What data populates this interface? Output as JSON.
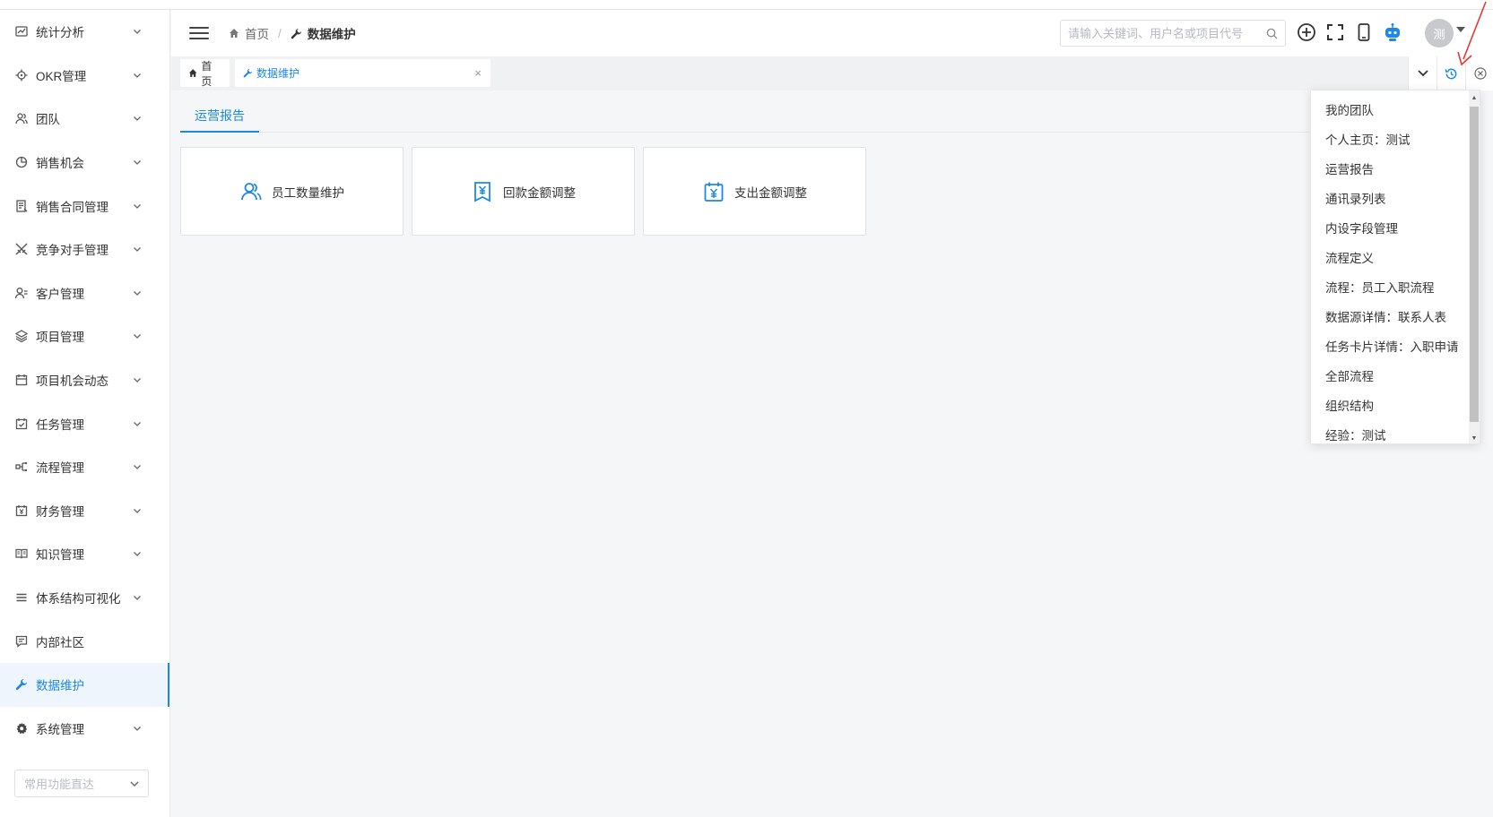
{
  "sidebar": {
    "items": [
      {
        "label": "统计分析",
        "icon": "chart-icon"
      },
      {
        "label": "OKR管理",
        "icon": "target-icon"
      },
      {
        "label": "团队",
        "icon": "team-icon"
      },
      {
        "label": "销售机会",
        "icon": "pie-icon"
      },
      {
        "label": "销售合同管理",
        "icon": "contract-icon"
      },
      {
        "label": "竞争对手管理",
        "icon": "swords-icon"
      },
      {
        "label": "客户管理",
        "icon": "customer-icon"
      },
      {
        "label": "项目管理",
        "icon": "layers-icon"
      },
      {
        "label": "项目机会动态",
        "icon": "calendar-icon"
      },
      {
        "label": "任务管理",
        "icon": "task-icon"
      },
      {
        "label": "流程管理",
        "icon": "flow-icon"
      },
      {
        "label": "财务管理",
        "icon": "finance-icon"
      },
      {
        "label": "知识管理",
        "icon": "book-icon"
      },
      {
        "label": "体系结构可视化",
        "icon": "menu-icon"
      },
      {
        "label": "内部社区",
        "icon": "comment-icon"
      },
      {
        "label": "数据维护",
        "icon": "wrench-icon"
      },
      {
        "label": "系统管理",
        "icon": "gear-icon"
      }
    ],
    "quick_select_placeholder": "常用功能直达"
  },
  "header": {
    "breadcrumb_home": "首页",
    "breadcrumb_current": "数据维护",
    "search_placeholder": "请输入关键词、用户名或项目代号",
    "avatar_text": "测"
  },
  "tabs": [
    {
      "label": "首页"
    },
    {
      "label": "数据维护"
    }
  ],
  "subtab": "运营报告",
  "cards": [
    {
      "label": "员工数量维护",
      "icon": "users-icon"
    },
    {
      "label": "回款金额调整",
      "icon": "yen-receipt-icon"
    },
    {
      "label": "支出金额调整",
      "icon": "yen-calendar-icon"
    }
  ],
  "history_dropdown": [
    "我的团队",
    "个人主页：测试",
    "运营报告",
    "通讯录列表",
    "内设字段管理",
    "流程定义",
    "流程：员工入职流程",
    "数据源详情：联系人表",
    "任务卡片详情：入职申请",
    "全部流程",
    "组织结构",
    "经验：测试"
  ],
  "colors": {
    "accent": "#1e88e5",
    "annotation_arrow": "#e53935"
  }
}
